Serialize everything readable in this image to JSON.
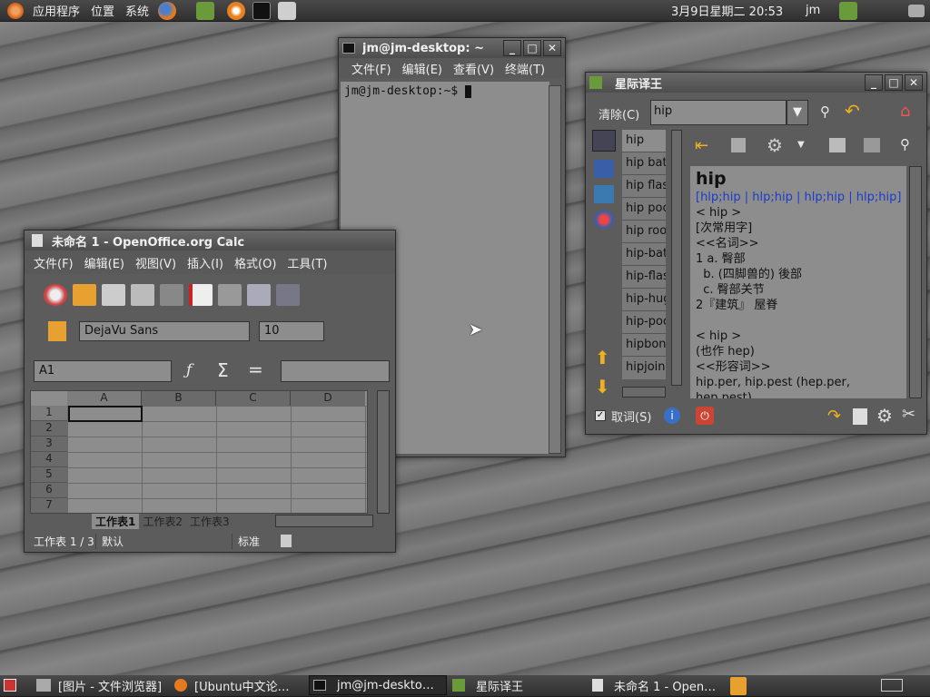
{
  "top_panel": {
    "apps": "应用程序",
    "places": "位置",
    "system": "系统",
    "datetime": "3月9日星期二 20:53",
    "user": "jm"
  },
  "terminal": {
    "title": "jm@jm-desktop: ~",
    "menu": [
      "文件(F)",
      "编辑(E)",
      "查看(V)",
      "终端(T)"
    ],
    "prompt": "jm@jm-desktop:~$"
  },
  "dict": {
    "title": "星际译王",
    "clear": "清除(C)",
    "query": "hip",
    "words": [
      "hip",
      "hip bat",
      "hip flas",
      "hip poc",
      "hip roo",
      "hip-bat",
      "hip-flas",
      "hip-hug",
      "hip-poo",
      "hipbon",
      "hipjoin"
    ],
    "entry": {
      "head": "hip",
      "phon": "[hlp;hip | hlp;hip | hlp;hip | hlp;hip]",
      "lines": [
        "< hip >",
        "[次常用字]",
        "<<名词>>",
        "1 a. 臀部",
        "  b. (四脚兽的) 後部",
        "  c. 臀部关节",
        "2『建筑』 屋脊",
        "",
        "< hip >",
        "(也作 hep)",
        "<<形容词>>",
        "hip.per, hip.pest (hep.per,",
        "hep.pest)"
      ]
    },
    "scan": "取词(S)"
  },
  "calc": {
    "title": "未命名 1 - OpenOffice.org Calc",
    "menu": [
      "文件(F)",
      "编辑(E)",
      "视图(V)",
      "插入(I)",
      "格式(O)",
      "工具(T)"
    ],
    "font": "DejaVu Sans",
    "size": "10",
    "cell": "A1",
    "cols": [
      "A",
      "B",
      "C",
      "D"
    ],
    "rows": [
      "1",
      "2",
      "3",
      "4",
      "5",
      "6",
      "7"
    ],
    "sheets": [
      "工作表1",
      "工作表2",
      "工作表3"
    ],
    "status": {
      "sheet": "工作表 1 / 3",
      "style": "默认",
      "mode": "标准"
    }
  },
  "taskbar": [
    "[图片 - 文件浏览器]",
    "[Ubuntu中文论…",
    "jm@jm-deskto…",
    "星际译王",
    "未命名 1 - Open…"
  ]
}
